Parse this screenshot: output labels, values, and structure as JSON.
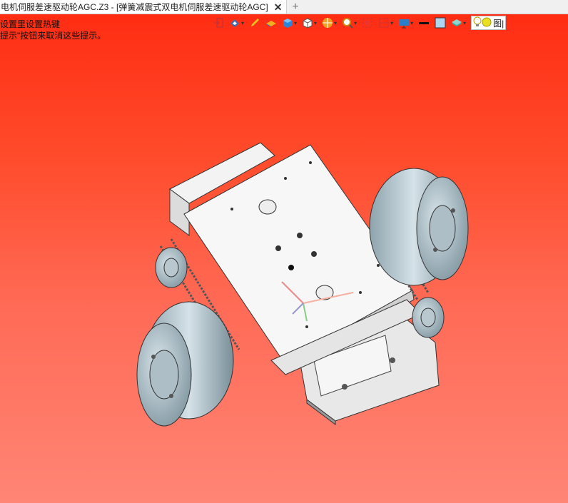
{
  "tab": {
    "title": "电机伺服差速驱动轮AGC.Z3 - [弹簧减震式双电机伺服差速驱动轮AGC]",
    "close": "✕",
    "add": "+"
  },
  "hints": {
    "line1": "设置里设置热键",
    "line2": "提示\"按钮来取消这些提示。"
  },
  "toolbar": {
    "search_label": "图|",
    "icons": [
      "exit-icon",
      "view-orientation-icon",
      "pen-icon",
      "shaded-render-icon",
      "cube-render-icon",
      "box-view-icon",
      "section-icon",
      "zoom-icon",
      "frame-icon",
      "grid-icon",
      "display-settings-icon",
      "line-color-icon",
      "face-color-icon",
      "layer-icon",
      "light-bulb-icon",
      "sun-icon"
    ]
  },
  "colors": {
    "bg_top": "#ff2a10",
    "bg_bottom": "#ff8575",
    "wheel": "#9fb3bc",
    "body": "#f4f4f4"
  }
}
